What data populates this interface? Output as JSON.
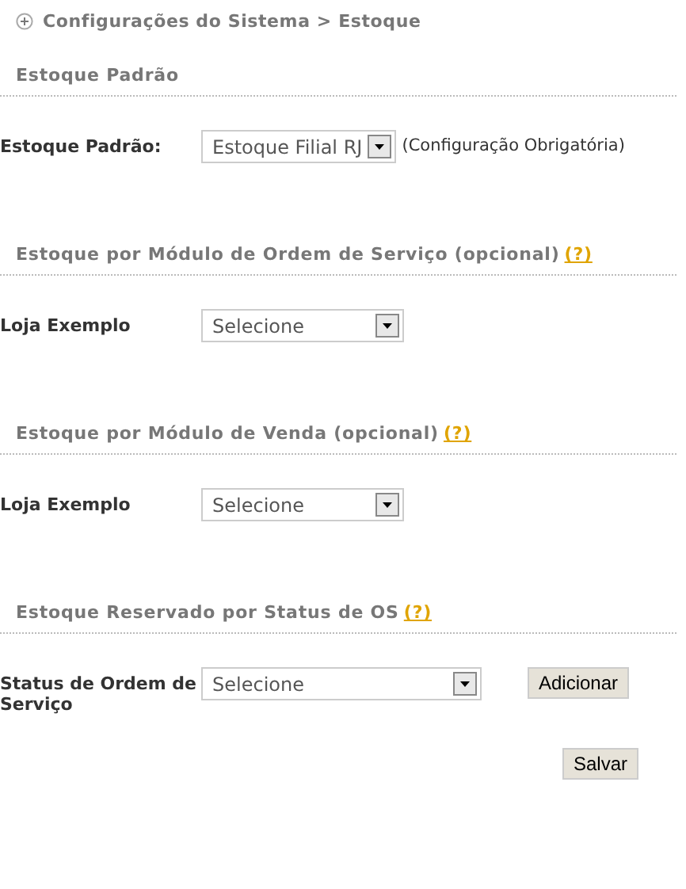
{
  "breadcrumb": "Configurações do Sistema > Estoque",
  "sections": [
    {
      "title": "Estoque Padrão",
      "rows": [
        {
          "label": "Estoque Padrão:",
          "select": "Estoque Filial RJ",
          "note": "(Configuração Obrigatória)"
        }
      ]
    },
    {
      "title": "Estoque por Módulo de Ordem de Serviço (opcional)",
      "help": "(?)",
      "rows": [
        {
          "label": "Loja Exemplo",
          "select": "Selecione"
        }
      ]
    },
    {
      "title": "Estoque por Módulo de Venda (opcional)",
      "help": "(?)",
      "rows": [
        {
          "label": "Loja Exemplo",
          "select": "Selecione"
        }
      ]
    },
    {
      "title": "Estoque Reservado por Status de OS",
      "help": "(?)",
      "rows": [
        {
          "label": "Status de Ordem de Serviço",
          "select": "Selecione",
          "button": "Adicionar"
        }
      ]
    }
  ],
  "save_button": "Salvar"
}
